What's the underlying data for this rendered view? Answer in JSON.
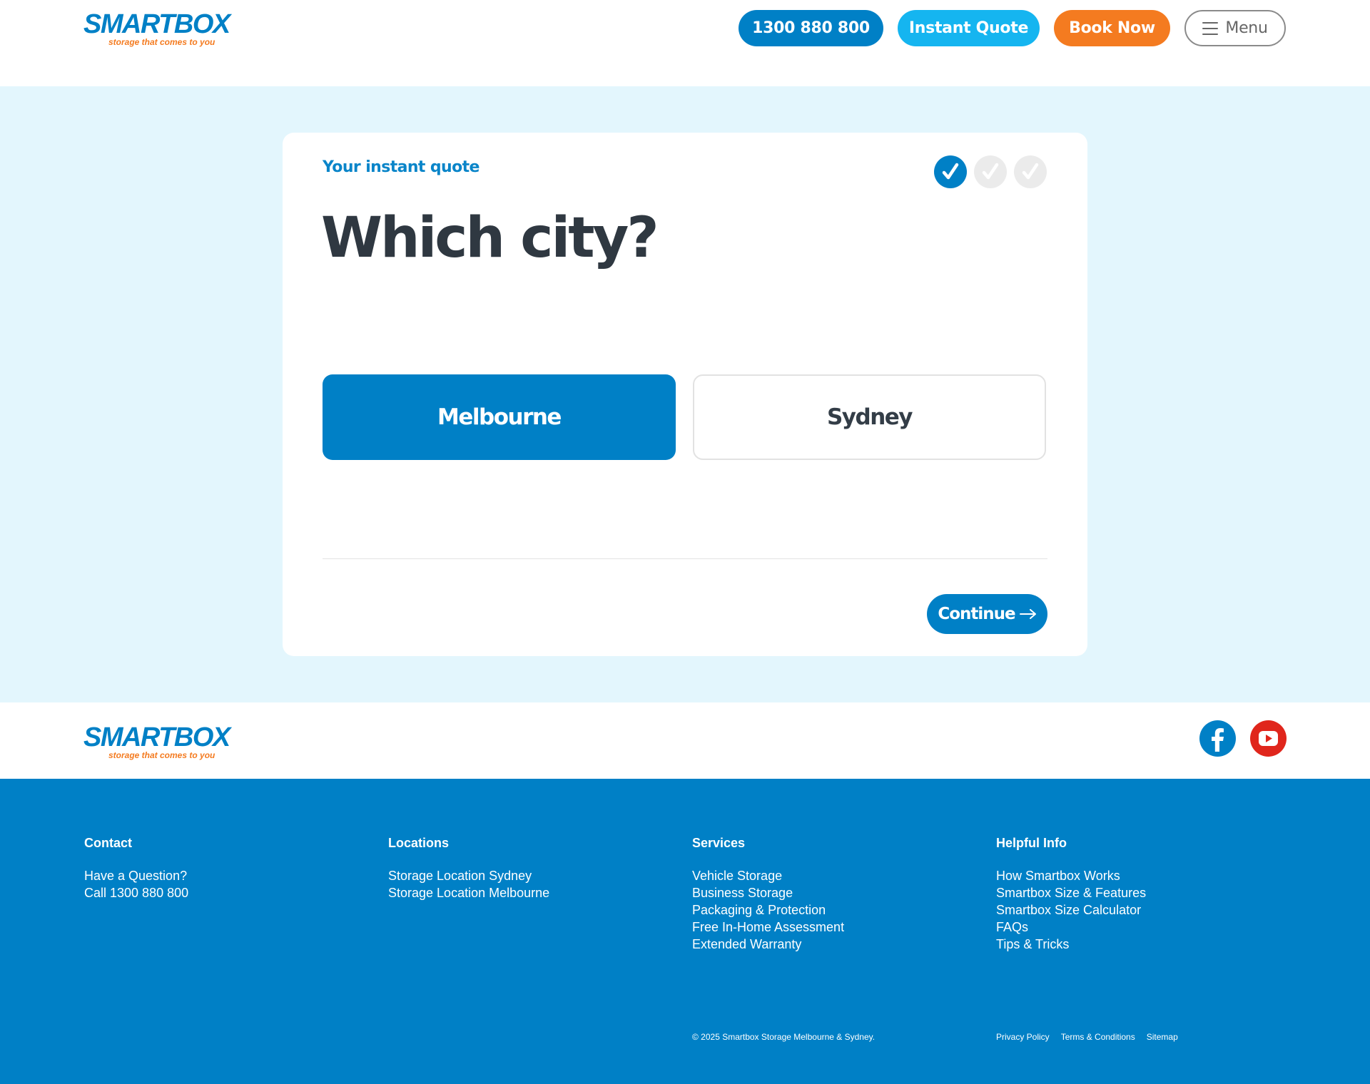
{
  "brand": {
    "name": "SMARTBOX",
    "tagline": "storage that comes to you",
    "colors": {
      "primary": "#0080c6",
      "light_blue": "#15b5f0",
      "orange": "#f47b20",
      "background": "#e3f6fd",
      "youtube": "#e0261c"
    }
  },
  "header": {
    "phone_label": "1300 880 800",
    "quote_label": "Instant Quote",
    "book_label": "Book Now",
    "menu_label": "Menu"
  },
  "quote": {
    "kicker": "Your instant quote",
    "heading": "Which city?",
    "steps": [
      {
        "icon": "check-icon",
        "state": "completed"
      },
      {
        "icon": "check-icon",
        "state": "pending"
      },
      {
        "icon": "check-icon",
        "state": "pending"
      }
    ],
    "options": [
      {
        "label": "Melbourne",
        "selected": true
      },
      {
        "label": "Sydney",
        "selected": false
      }
    ],
    "continue_label": "Continue"
  },
  "social": [
    {
      "icon": "facebook-icon"
    },
    {
      "icon": "youtube-icon"
    }
  ],
  "footer": {
    "columns": [
      {
        "title": "Contact",
        "items": [
          "Have a Question?",
          "Call 1300 880 800"
        ]
      },
      {
        "title": "Locations",
        "items": [
          "Storage Location Sydney",
          "Storage Location Melbourne"
        ]
      },
      {
        "title": "Services",
        "items": [
          "Vehicle Storage",
          "Business Storage",
          "Packaging & Protection",
          "Free In-Home Assessment",
          "Extended Warranty"
        ]
      },
      {
        "title": "Helpful Info",
        "items": [
          "How Smartbox Works",
          "Smartbox Size & Features",
          "Smartbox Size Calculator",
          "FAQs",
          "Tips & Tricks"
        ]
      }
    ],
    "copyright": "© 2025 Smartbox Storage Melbourne & Sydney.",
    "legal": [
      "Privacy Policy",
      "Terms & Conditions",
      "Sitemap"
    ]
  }
}
